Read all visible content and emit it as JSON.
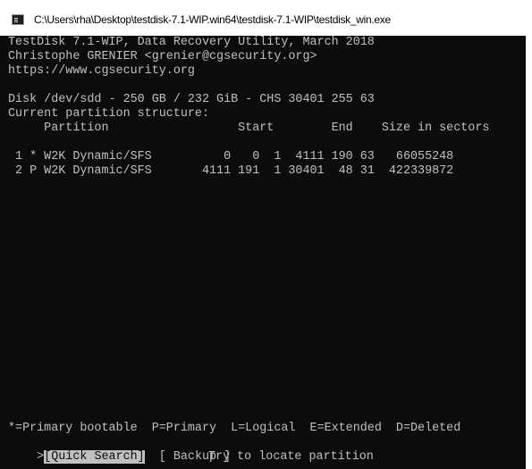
{
  "window": {
    "title": "C:\\Users\\rha\\Desktop\\testdisk-7.1-WIP.win64\\testdisk-7.1-WIP\\testdisk_win.exe"
  },
  "console": {
    "header": [
      "TestDisk 7.1-WIP, Data Recovery Utility, March 2018",
      "Christophe GRENIER <grenier@cgsecurity.org>",
      "https://www.cgsecurity.org"
    ],
    "disk_info": "Disk /dev/sdd - 250 GB / 232 GiB - CHS 30401 255 63",
    "structure_label": "Current partition structure:",
    "column_header": "     Partition                  Start        End    Size in sectors",
    "partitions": [
      " 1 * W2K Dynamic/SFS          0   0  1  4111 190 63   66055248",
      " 2 P W2K Dynamic/SFS       4111 191  1 30401  48 31  422339872"
    ],
    "legend": "*=Primary bootable  P=Primary  L=Logical  E=Extended  D=Deleted",
    "menu": {
      "cursor": ">",
      "quick_search": "[Quick Search]",
      "backup": "[ Backup ]"
    },
    "hint": "Try to locate partition"
  },
  "colors": {
    "console_bg": "#0c0c0c",
    "console_fg": "#c0c0c0",
    "selection_bg": "#c0c0c0"
  },
  "icons": {
    "title_icon": "console-window-icon"
  }
}
